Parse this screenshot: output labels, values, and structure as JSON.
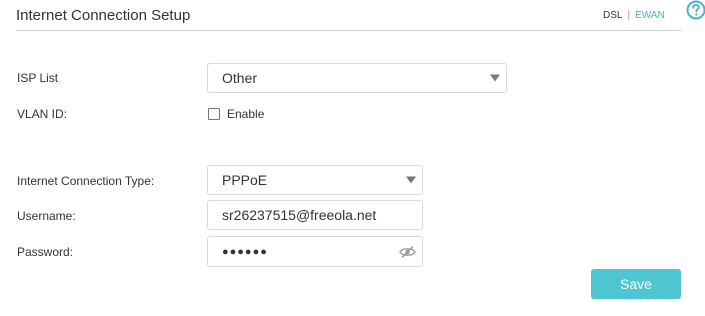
{
  "header": {
    "title": "Internet Connection Setup",
    "mode_dsl": "DSL",
    "mode_separator": "|",
    "mode_ewan": "EWAN",
    "help_icon": "question-circle-icon"
  },
  "form": {
    "isp_list": {
      "label": "ISP List",
      "value": "Other"
    },
    "vlan_id": {
      "label": "VLAN ID:",
      "checkbox_label": "Enable",
      "checked": false
    },
    "connection_type": {
      "label": "Internet Connection Type:",
      "value": "PPPoE"
    },
    "username": {
      "label": "Username:",
      "value": "sr26237515@freeola.net"
    },
    "password": {
      "label": "Password:",
      "value": "●●●●●●",
      "toggle_icon": "eye-slash-icon"
    }
  },
  "actions": {
    "save_label": "Save"
  },
  "colors": {
    "accent": "#4ec6d2",
    "link": "#4ab3c8",
    "border": "#d9d9d9"
  }
}
